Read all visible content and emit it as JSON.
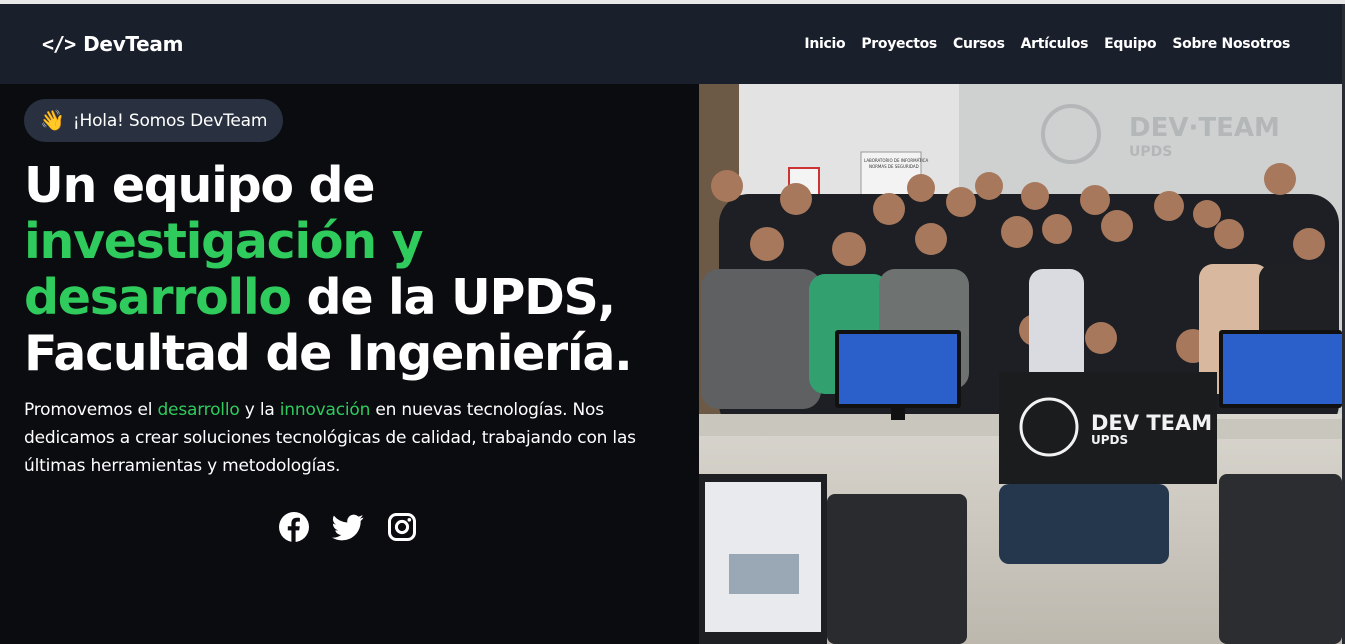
{
  "header": {
    "brand_icon": "</>",
    "brand_name": "DevTeam",
    "nav": [
      "Inicio",
      "Proyectos",
      "Cursos",
      "Artículos",
      "Equipo",
      "Sobre Nosotros"
    ]
  },
  "hero": {
    "badge_icon": "👋",
    "badge_text": "¡Hola! Somos DevTeam",
    "headline": {
      "line1": "Un equipo de",
      "green": "investigación y desarrollo",
      "after_green": " de la UPDS,",
      "line_last": "Facultad de Ingeniería."
    },
    "description": {
      "part1": "Promovemos el ",
      "highlight1": "desarrollo",
      "part2": " y la ",
      "highlight2": "innovación",
      "part3": " en nuevas tecnologías. Nos dedicamos a crear soluciones tecnológicas de calidad, trabajando con las últimas herramientas y metodologías."
    },
    "socials": [
      "facebook-icon",
      "twitter-icon",
      "instagram-icon"
    ],
    "photo": {
      "wall_logo": "DEV·TEAM",
      "wall_logo_sub": "UPDS",
      "banner_title": "DEV TEAM",
      "banner_sub": "UPDS",
      "wall_sign_title": "LABORATORIO DE INFORMÁTICA",
      "wall_sign_sub": "NORMAS DE SEGURIDAD"
    }
  },
  "colors": {
    "accent_green": "#2fcb5d",
    "header_bg": "#1a1f2c",
    "page_bg": "#0b0c10",
    "badge_bg": "#293140"
  }
}
